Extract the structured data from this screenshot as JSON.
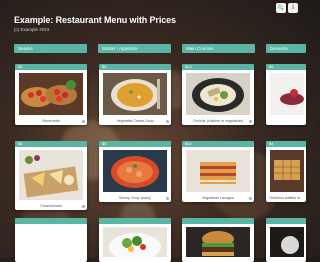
{
  "page": {
    "title": "Example: Restaurant Menu with Prices",
    "subtitle": "(c) Example 2023"
  },
  "toolbar": {
    "search_glyph": "🔍",
    "info_glyph": "i"
  },
  "columns": [
    {
      "label": "Snacks",
      "cards": [
        {
          "tag": "$4",
          "caption": "Bruschetta",
          "photo": "bruschetta"
        },
        {
          "tag": "$8",
          "caption": "Cheeseboard",
          "photo": "cheeseboard"
        }
      ]
    },
    {
      "label": "Starter / Appetizer",
      "cards": [
        {
          "tag": "$4",
          "caption": "Vegetable Cream Soup",
          "photo": "soup"
        },
        {
          "tag": "$5",
          "caption": "Shrimp Soup (spicy)",
          "photo": "shrimp-soup"
        }
      ]
    },
    {
      "label": "Main Courses",
      "cards": [
        {
          "tag": "$14",
          "caption": "Ceviche (chicken or vegetarian)",
          "photo": "ceviche"
        },
        {
          "tag": "$12",
          "caption": "Vegetarian Lasagne",
          "photo": "lasagne"
        }
      ]
    },
    {
      "label": "Desserts",
      "cards": [
        {
          "tag": "$5",
          "caption": "",
          "photo": "dessert"
        },
        {
          "tag": "$4",
          "caption": "Delicious waffles w...",
          "photo": "waffles"
        }
      ]
    }
  ],
  "colors": {
    "accent": "#5bb5a4"
  }
}
